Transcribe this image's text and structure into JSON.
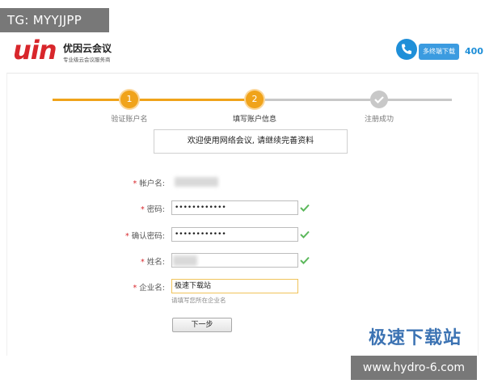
{
  "overlay": {
    "tg_tag": "TG: MYYJJPP",
    "site_watermark": "极速下载站",
    "site_url": "www.hydro-6.com"
  },
  "header": {
    "logo_mark": "uin",
    "logo_title": "优因云会议",
    "logo_subtitle": "专业级云会议服务商",
    "download_button": "多终端下载",
    "hotline": "400"
  },
  "steps": [
    {
      "number": "1",
      "label": "验证账户名",
      "state": "done"
    },
    {
      "number": "2",
      "label": "填写账户信息",
      "state": "current"
    },
    {
      "number": "",
      "label": "注册成功",
      "state": "pending"
    }
  ],
  "welcome_message": "欢迎使用网络会议, 请继续完善资料",
  "form": {
    "required_mark": "*",
    "account": {
      "label": "帐户名:"
    },
    "password": {
      "label": "密码:",
      "value": "••••••••••••"
    },
    "confirm_password": {
      "label": "确认密码:",
      "value": "••••••••••••"
    },
    "name": {
      "label": "姓名:"
    },
    "company": {
      "label": "企业名:",
      "value": "极速下载站",
      "hint": "请填写您所在企业名"
    },
    "next_button": "下一步"
  },
  "colors": {
    "brand_red": "#d8262b",
    "step_orange": "#f0a31a",
    "accent_blue": "#1f8fd8",
    "valid_green": "#5cb85c"
  }
}
